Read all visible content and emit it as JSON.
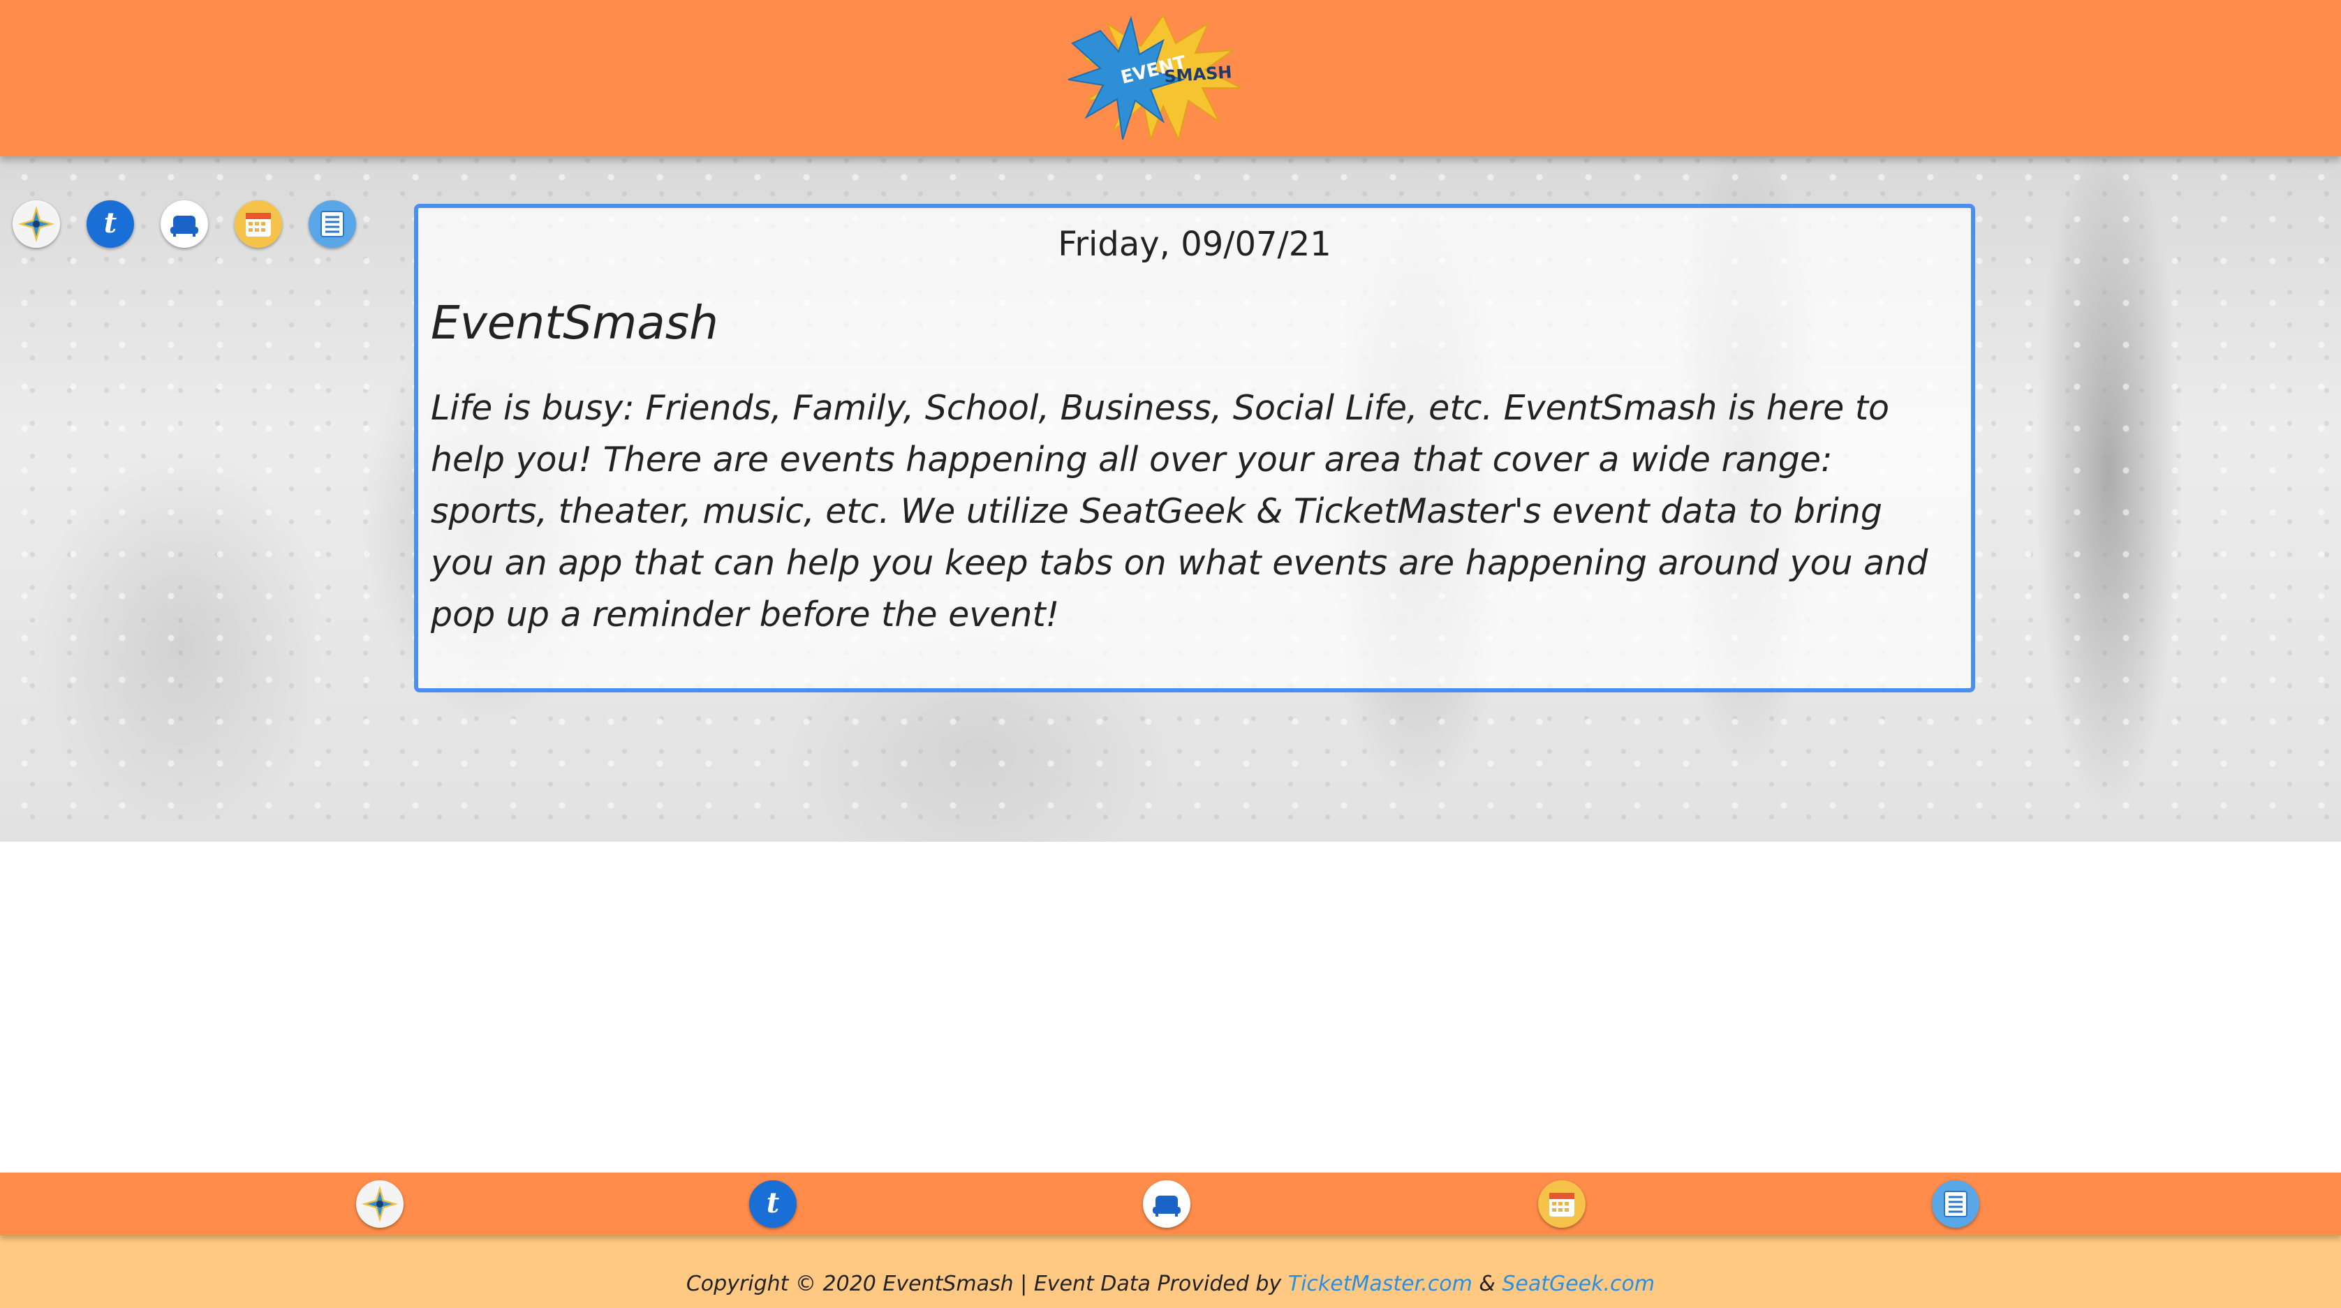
{
  "header": {
    "logo_text_left": "EVENT",
    "logo_text_right": "SMASH"
  },
  "nav": {
    "items": [
      {
        "name": "compass-icon",
        "label": "EventSmash"
      },
      {
        "name": "ticketmaster-icon",
        "label": "t"
      },
      {
        "name": "seatgeek-icon",
        "label": "SeatGeek"
      },
      {
        "name": "calendar-icon",
        "label": "Calendar"
      },
      {
        "name": "list-icon",
        "label": "List"
      }
    ]
  },
  "card": {
    "date": "Friday, 09/07/21",
    "title": "EventSmash",
    "text": "Life is busy: Friends, Family, School, Business, Social Life, etc. EventSmash is here to help you! There are events happening all over your area that cover a wide range: sports, theater, music, etc. We utilize SeatGeek & TicketMaster's event data to bring you an app that can help you keep tabs on what events are happening around you and pop up a reminder before the event!"
  },
  "footer": {
    "copyright": "Copyright © 2020 EventSmash | Event Data Provided by",
    "link1": "TicketMaster.com",
    "separator": "&",
    "link2": "SeatGeek.com"
  },
  "colors": {
    "header_orange": "#ff8c4a",
    "footer_peach": "#ffc983",
    "card_border": "#4a8ef0",
    "link_blue": "#2b8fe0"
  }
}
